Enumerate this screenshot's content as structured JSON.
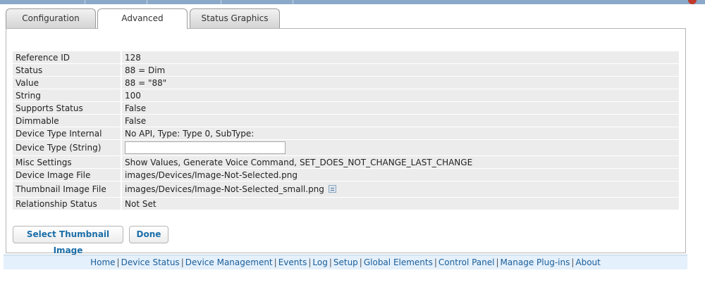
{
  "tabs": [
    {
      "label": "Configuration"
    },
    {
      "label": "Advanced"
    },
    {
      "label": "Status Graphics"
    }
  ],
  "properties": [
    {
      "label": "Reference ID",
      "value": "128"
    },
    {
      "label": "Status",
      "value": "88 = Dim"
    },
    {
      "label": "Value",
      "value": "88 = \"88\""
    },
    {
      "label": "String",
      "value": "100"
    },
    {
      "label": "Supports Status",
      "value": "False"
    },
    {
      "label": "Dimmable",
      "value": "False"
    },
    {
      "label": "Device Type Internal",
      "value": "No API, Type: Type 0, SubType:"
    },
    {
      "label": "Device Type (String)",
      "value": ""
    },
    {
      "label": "Misc Settings",
      "value": "Show Values, Generate Voice Command, SET_DOES_NOT_CHANGE_LAST_CHANGE"
    },
    {
      "label": "Device Image File",
      "value": "images/Devices/Image-Not-Selected.png"
    },
    {
      "label": "Thumbnail Image File",
      "value": "images/Devices/Image-Not-Selected_small.png"
    },
    {
      "label": "Relationship Status",
      "value": "Not Set"
    }
  ],
  "buttons": {
    "select_thumbnail": "Select Thumbnail Image",
    "done": "Done"
  },
  "footer": {
    "links": [
      "Home",
      "Device Status",
      "Device Management",
      "Events",
      "Log",
      "Setup",
      "Global Elements",
      "Control Panel",
      "Manage Plug-ins",
      "About"
    ],
    "separator": "|"
  }
}
